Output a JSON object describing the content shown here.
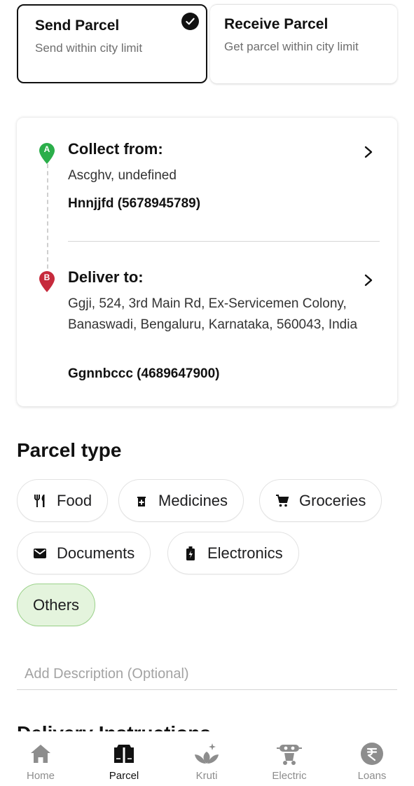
{
  "modes": {
    "send": {
      "title": "Send Parcel",
      "subtitle": "Send within city limit",
      "selected": true
    },
    "receive": {
      "title": "Receive Parcel",
      "subtitle": "Get parcel within city limit",
      "selected": false
    }
  },
  "route": {
    "pickup": {
      "badge": "A",
      "title": "Collect from:",
      "address": "Ascghv, undefined",
      "contact": "Hnnjjfd (5678945789)",
      "color": "#2bae4a"
    },
    "drop": {
      "badge": "B",
      "title": "Deliver to:",
      "address": "Ggji, 524, 3rd Main Rd, Ex-Servicemen Colony, Banaswadi, Bengaluru, Karnataka, 560043, India",
      "contact": "Ggnnbccc (4689647900)",
      "color": "#c62a3c"
    }
  },
  "parcel_type": {
    "title": "Parcel type",
    "options": [
      {
        "label": "Food",
        "icon": "fork-knife-icon",
        "selected": false
      },
      {
        "label": "Medicines",
        "icon": "medicine-icon",
        "selected": false
      },
      {
        "label": "Groceries",
        "icon": "cart-icon",
        "selected": false
      },
      {
        "label": "Documents",
        "icon": "envelope-icon",
        "selected": false
      },
      {
        "label": "Electronics",
        "icon": "battery-icon",
        "selected": false
      },
      {
        "label": "Others",
        "icon": "",
        "selected": true
      }
    ],
    "selected_color": "#e4f4dd"
  },
  "description": {
    "placeholder": "Add Description (Optional)",
    "value": ""
  },
  "next_section": {
    "title": "Delivery Instructions"
  },
  "bottom_nav": [
    {
      "label": "Home",
      "icon": "home-icon",
      "active": false
    },
    {
      "label": "Parcel",
      "icon": "parcel-icon",
      "active": true
    },
    {
      "label": "Kruti",
      "icon": "kruti-icon",
      "active": false
    },
    {
      "label": "Electric",
      "icon": "electric-icon",
      "active": false
    },
    {
      "label": "Loans",
      "icon": "rupee-icon",
      "active": false
    }
  ]
}
